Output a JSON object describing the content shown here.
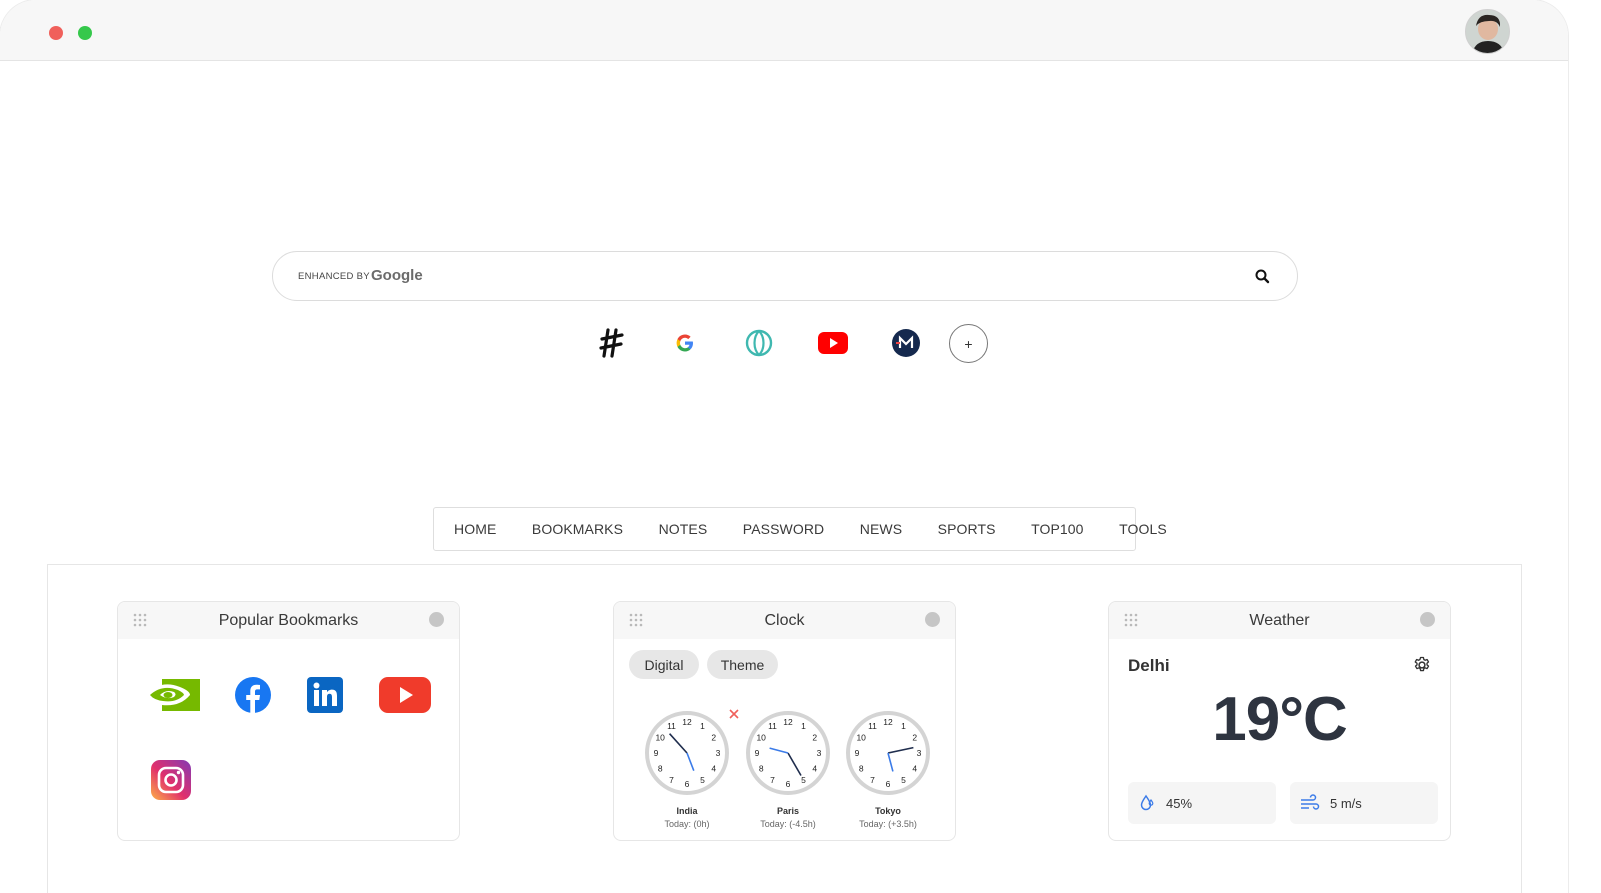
{
  "search": {
    "enhanced_by": "ENHANCED BY",
    "brand": "Google",
    "placeholder": ""
  },
  "shortcuts": [
    {
      "icon": "hashnode-icon"
    },
    {
      "icon": "google-icon"
    },
    {
      "icon": "grammarly-icon"
    },
    {
      "icon": "youtube-icon"
    },
    {
      "icon": "m-icon"
    }
  ],
  "add_shortcut_label": "+",
  "nav": {
    "items": [
      "HOME",
      "BOOKMARKS",
      "NOTES",
      "PASSWORD",
      "NEWS",
      "SPORTS",
      "TOP100",
      "TOOLS"
    ]
  },
  "bookmarks_card": {
    "title": "Popular Bookmarks",
    "items": [
      "nvidia-icon",
      "facebook-icon",
      "linkedin-icon",
      "youtube-icon",
      "instagram-icon"
    ]
  },
  "clock_card": {
    "title": "Clock",
    "tabs": [
      "Digital",
      "Theme"
    ],
    "clocks": [
      {
        "city": "India",
        "offset": "Today: (0h)"
      },
      {
        "city": "Paris",
        "offset": "Today: (-4.5h)"
      },
      {
        "city": "Tokyo",
        "offset": "Today: (+3.5h)"
      }
    ]
  },
  "weather_card": {
    "title": "Weather",
    "city": "Delhi",
    "temperature": "19°C",
    "humidity": "45%",
    "wind": "5 m/s"
  },
  "colors": {
    "accent_blue": "#3b7be8",
    "close_red": "#f0605b",
    "maximize_green": "#35c84b"
  }
}
